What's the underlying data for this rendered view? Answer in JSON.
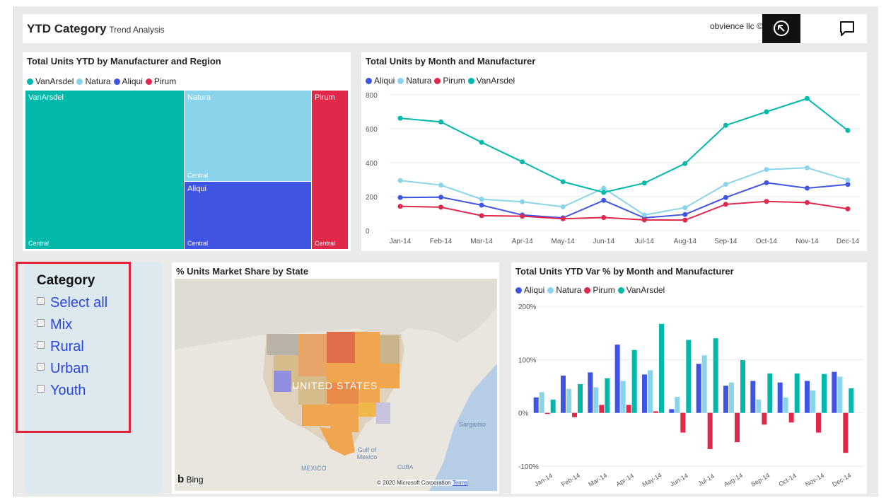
{
  "header": {
    "title": "YTD Category",
    "subtitle": "Trend Analysis",
    "company": "obvience llc ©"
  },
  "treemap": {
    "title": "Total Units YTD by Manufacturer and Region",
    "legend": [
      {
        "name": "VanArsdel",
        "color": "#01b8aa"
      },
      {
        "name": "Natura",
        "color": "#8ad4eb"
      },
      {
        "name": "Aliqui",
        "color": "#4054e3"
      },
      {
        "name": "Pirum",
        "color": "#e0284a"
      }
    ],
    "cells": [
      {
        "manufacturer": "VanArsdel",
        "region": "Central",
        "color": "#01b8aa"
      },
      {
        "manufacturer": "Natura",
        "region": "Central",
        "color": "#8ad4eb"
      },
      {
        "manufacturer": "Aliqui",
        "region": "Central",
        "color": "#4054e3"
      },
      {
        "manufacturer": "Pirum",
        "region": "Central",
        "color": "#e0284a"
      }
    ]
  },
  "line_chart": {
    "title": "Total Units by Month and Manufacturer"
  },
  "slicer": {
    "title": "Category",
    "items": [
      "Select all",
      "Mix",
      "Rural",
      "Urban",
      "Youth"
    ]
  },
  "map": {
    "title": "% Units Market Share by State",
    "labels": {
      "country": "UNITED STATES",
      "gulf": "Gulf of Mexico",
      "mexico": "MEXICO",
      "sargasso": "Sargasso",
      "cuba": "CUBA"
    },
    "provider": "Bing",
    "copyright": "© 2020 Microsoft Corporation",
    "terms": "Terms"
  },
  "bar_chart": {
    "title": "Total Units YTD Var % by Month and Manufacturer"
  },
  "chart_data": [
    {
      "type": "line",
      "title": "Total Units by Month and Manufacturer",
      "categories": [
        "Jan-14",
        "Feb-14",
        "Mar-14",
        "Apr-14",
        "May-14",
        "Jun-14",
        "Jul-14",
        "Aug-14",
        "Sep-14",
        "Oct-14",
        "Nov-14",
        "Dec-14"
      ],
      "ylim": [
        0,
        800
      ],
      "yticks": [
        "0",
        "200",
        "400",
        "600",
        "800"
      ],
      "grid": true,
      "legend_position": "top-left",
      "series": [
        {
          "name": "Aliqui",
          "color": "#4054e3",
          "values": [
            195,
            197,
            150,
            92,
            75,
            178,
            75,
            95,
            195,
            282,
            250,
            272
          ]
        },
        {
          "name": "Natura",
          "color": "#8ad4eb",
          "values": [
            295,
            268,
            185,
            170,
            140,
            250,
            92,
            135,
            273,
            360,
            370,
            298
          ]
        },
        {
          "name": "Pirum",
          "color": "#e0284a",
          "values": [
            143,
            138,
            88,
            85,
            70,
            77,
            63,
            62,
            155,
            172,
            165,
            128
          ]
        },
        {
          "name": "VanArsdel",
          "color": "#01b8aa",
          "values": [
            662,
            640,
            520,
            405,
            288,
            225,
            280,
            395,
            620,
            700,
            778,
            590
          ]
        }
      ]
    },
    {
      "type": "bar",
      "title": "Total Units YTD Var % by Month and Manufacturer",
      "categories": [
        "Jan-14",
        "Feb-14",
        "Mar-14",
        "Apr-14",
        "May-14",
        "Jun-14",
        "Jul-14",
        "Aug-14",
        "Sep-14",
        "Oct-14",
        "Nov-14",
        "Dec-14"
      ],
      "ylim": [
        -100,
        200
      ],
      "yticks": [
        "-100%",
        "0%",
        "100%",
        "200%"
      ],
      "grid": true,
      "legend_position": "top-left",
      "series": [
        {
          "name": "Aliqui",
          "color": "#4054e3",
          "values": [
            29,
            70,
            76,
            128,
            72,
            7,
            92,
            51,
            60,
            57,
            60,
            77
          ]
        },
        {
          "name": "Natura",
          "color": "#8ad4eb",
          "values": [
            39,
            45,
            48,
            60,
            80,
            30,
            108,
            57,
            25,
            29,
            42,
            68
          ]
        },
        {
          "name": "Pirum",
          "color": "#e0284a",
          "values": [
            -2,
            -8,
            15,
            15,
            3,
            -37,
            -68,
            -55,
            -22,
            -18,
            -37,
            -75
          ]
        },
        {
          "name": "VanArsdel",
          "color": "#01b8aa",
          "values": [
            25,
            54,
            65,
            118,
            167,
            137,
            140,
            99,
            74,
            74,
            73,
            46
          ]
        }
      ]
    }
  ]
}
